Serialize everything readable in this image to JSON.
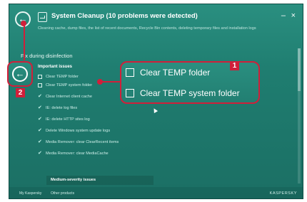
{
  "window": {
    "title": "System Cleanup (10 problems were detected)",
    "description": "Cleaning cache, dump files, the list of recent documents, Recycle Bin contents, deleting temporary files and installation logs",
    "min_label": "‒",
    "close_label": "×",
    "back_icon": "←"
  },
  "section": {
    "title": "Fix during disinfection"
  },
  "list": {
    "important_header": "Important issues",
    "items": [
      {
        "label": "Clear TEMP folder",
        "state": "unchecked"
      },
      {
        "label": "Clear TEMP system folder",
        "state": "unchecked"
      },
      {
        "label": "Clear Internet client cache",
        "state": "checked"
      },
      {
        "label": "IE: delete log files",
        "state": "checked"
      },
      {
        "label": "IE: delete HTTP sites log",
        "state": "checked"
      },
      {
        "label": "Delete Windows system update logs",
        "state": "checked"
      },
      {
        "label": "Media Remover: clear ClearRecent items",
        "state": "checked"
      },
      {
        "label": "Media Remover: clear MediaCache",
        "state": "checked"
      }
    ],
    "medium_header": "Medium-severity issues"
  },
  "zoom": {
    "items": [
      {
        "label": "Clear TEMP folder"
      },
      {
        "label": "Clear TEMP system folder"
      }
    ]
  },
  "markers": {
    "one": "1",
    "two": "2"
  },
  "footer": {
    "link1": "My Kaspersky",
    "link2": "Other products",
    "brand": "KASPERSKY"
  },
  "colors": {
    "accent": "#d11f3a",
    "window_bg": "#237f72"
  }
}
